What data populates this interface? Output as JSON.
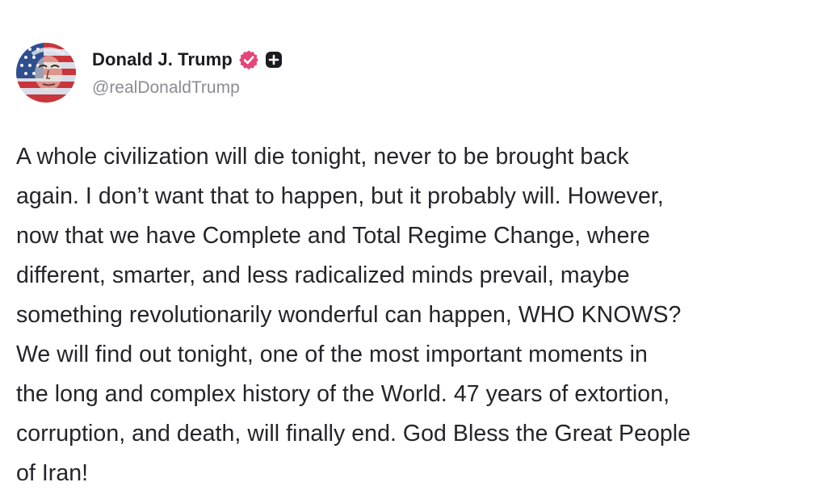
{
  "author": {
    "display_name": "Donald J. Trump",
    "handle": "@realDonaldTrump",
    "avatar_icon": "american-flag-portrait-avatar",
    "verified_icon": "verified-badge-icon",
    "verified_color": "#e6457a",
    "plus_icon": "plus-badge-icon"
  },
  "post": {
    "lines": [
      "A whole civilization will die tonight, never to be brought back",
      "again. I don’t want that to happen, but it probably will. However,",
      "now that we have Complete and Total Regime Change, where",
      "different, smarter, and less radicalized minds prevail, maybe",
      "something revolutionarily wonderful can happen, WHO KNOWS?",
      "We will find out tonight, one of the most important moments in",
      "the long and complex history of the World. 47 years of extortion,",
      "corruption, and death, will finally end. God Bless the Great People",
      "of Iran!"
    ]
  },
  "colors": {
    "text": "#24242a",
    "handle": "#8b8b93",
    "background": "#ffffff"
  }
}
